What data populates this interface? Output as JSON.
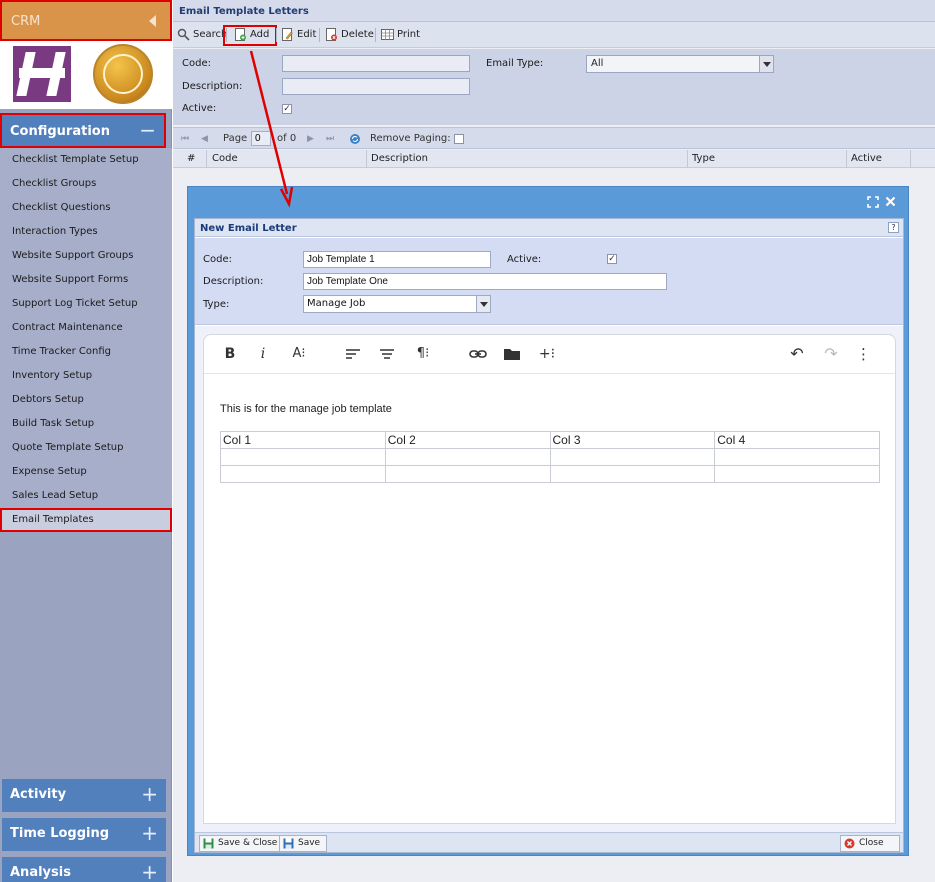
{
  "sidebar": {
    "crm_label": "CRM",
    "config_label": "Configuration",
    "config_sign": "−",
    "menu": [
      "Checklist Template Setup",
      "Checklist Groups",
      "Checklist Questions",
      "Interaction Types",
      "Website Support Groups",
      "Website Support Forms",
      "Support Log Ticket Setup",
      "Contract Maintenance",
      "Time Tracker Config",
      "Inventory Setup",
      "Debtors Setup",
      "Build Task Setup",
      "Quote Template Setup",
      "Expense Setup",
      "Sales Lead Setup",
      "Email Templates"
    ],
    "active_item": "Email Templates",
    "bottom_sections": [
      {
        "label": "Activity",
        "sign": "+"
      },
      {
        "label": "Time Logging",
        "sign": "+"
      },
      {
        "label": "Analysis",
        "sign": "+"
      }
    ]
  },
  "main": {
    "title": "Email Template Letters",
    "toolbar": {
      "search": "Search",
      "add": "Add",
      "edit": "Edit",
      "delete": "Delete",
      "print": "Print"
    },
    "filter": {
      "code_label": "Code:",
      "code_value": "",
      "description_label": "Description:",
      "description_value": "",
      "active_label": "Active:",
      "active_checked": "✓",
      "email_type_label": "Email Type:",
      "email_type_value": "All"
    },
    "pager": {
      "page_label": "Page",
      "page_value": "0",
      "of_label": "of 0",
      "remove_paging": "Remove Paging:"
    },
    "grid_columns": [
      "#",
      "Code",
      "Description",
      "Type",
      "Active"
    ]
  },
  "modal": {
    "title": "New Email Letter",
    "help": "?",
    "code_label": "Code:",
    "code_value": "Job Template 1",
    "active_label": "Active:",
    "active_checked": "✓",
    "description_label": "Description:",
    "description_value": "Job Template One",
    "type_label": "Type:",
    "type_value": "Manage Job",
    "editor": {
      "bold": "B",
      "italic": "i",
      "font_size": "A⁝",
      "align": "≡",
      "paragraph": "¶⁝",
      "more": "+⁝",
      "undo": "↶",
      "redo": "↷",
      "menu": "⋮",
      "body_text": "This is for the manage job template",
      "table": [
        [
          "Col 1",
          "Col 2",
          "Col 3",
          "Col 4"
        ],
        [
          "",
          "",
          "",
          ""
        ],
        [
          "",
          "",
          "",
          ""
        ]
      ]
    },
    "footer": {
      "save_close": "Save & Close",
      "save": "Save",
      "close": "Close"
    }
  },
  "colors": {
    "highlight_red": "#e00000",
    "modal_blue": "#5a9ad9",
    "section_blue": "#5280bd"
  }
}
